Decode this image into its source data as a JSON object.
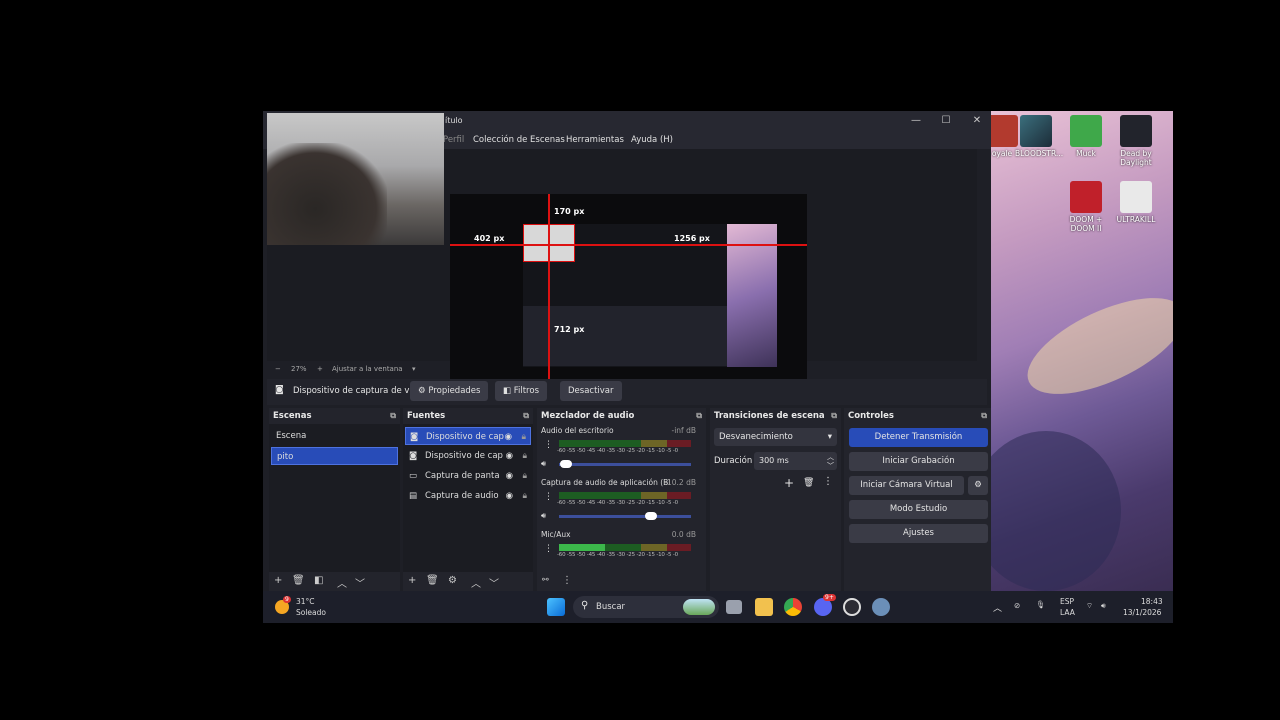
{
  "window": {
    "title_fragment": "ítulo",
    "minimize": "—",
    "maximize": "☐",
    "close": "✕"
  },
  "menu": {
    "items": [
      "Perfil",
      "Colección de Escenas",
      "Herramientas",
      "Ayuda (H)"
    ]
  },
  "preview": {
    "labels": {
      "top": "170 px",
      "left": "402 px",
      "right": "1256 px",
      "bottom": "712 px"
    }
  },
  "zoom": {
    "minus": "−",
    "value": "27%",
    "plus": "+",
    "mode": "Ajustar a la ventana"
  },
  "source_toolbar": {
    "source_name": "Dispositivo de captura de v",
    "properties": "Propiedades",
    "filters": "Filtros",
    "deactivate": "Desactivar"
  },
  "docks": {
    "scenes": {
      "title": "Escenas",
      "items": [
        "Escena",
        "pito"
      ],
      "selected": "pito"
    },
    "sources": {
      "title": "Fuentes",
      "items": [
        "Dispositivo de cap",
        "Dispositivo de cap",
        "Captura de panta",
        "Captura de audio"
      ]
    },
    "mixer": {
      "title": "Mezclador de audio",
      "scale": "-60 -55 -50 -45 -40 -35 -30 -25 -20 -15 -10 -5 -0",
      "channels": [
        {
          "name": "Audio del escritorio",
          "db": "-inf dB",
          "volume": 0.05
        },
        {
          "name": "Captura de audio de aplicación (Bl",
          "db": "-10.2 dB",
          "volume": 0.7
        },
        {
          "name": "Mic/Aux",
          "db": "0.0 dB",
          "volume": 1.0
        }
      ]
    },
    "transitions": {
      "title": "Transiciones de escena",
      "transition": "Desvanecimiento",
      "duration_label": "Duración",
      "duration_value": "300 ms"
    },
    "controls": {
      "title": "Controles",
      "buttons": [
        "Detener Transmisión",
        "Iniciar Grabación",
        "Iniciar Cámara Virtual",
        "Modo Estudio",
        "Ajustes"
      ]
    }
  },
  "desktop_icons": [
    "oyale",
    "BLOODSTR...",
    "Muck",
    "Dead by Daylight",
    "DOOM + DOOM II",
    "ULTRAKILL"
  ],
  "taskbar": {
    "weather_temp": "31°C",
    "weather_desc": "Soleado",
    "weather_badge": "9",
    "search": "Buscar",
    "discord_badge": "9+",
    "lang": "ESP",
    "region": "LAA",
    "time": "18:43",
    "date": "13/1/2026"
  }
}
